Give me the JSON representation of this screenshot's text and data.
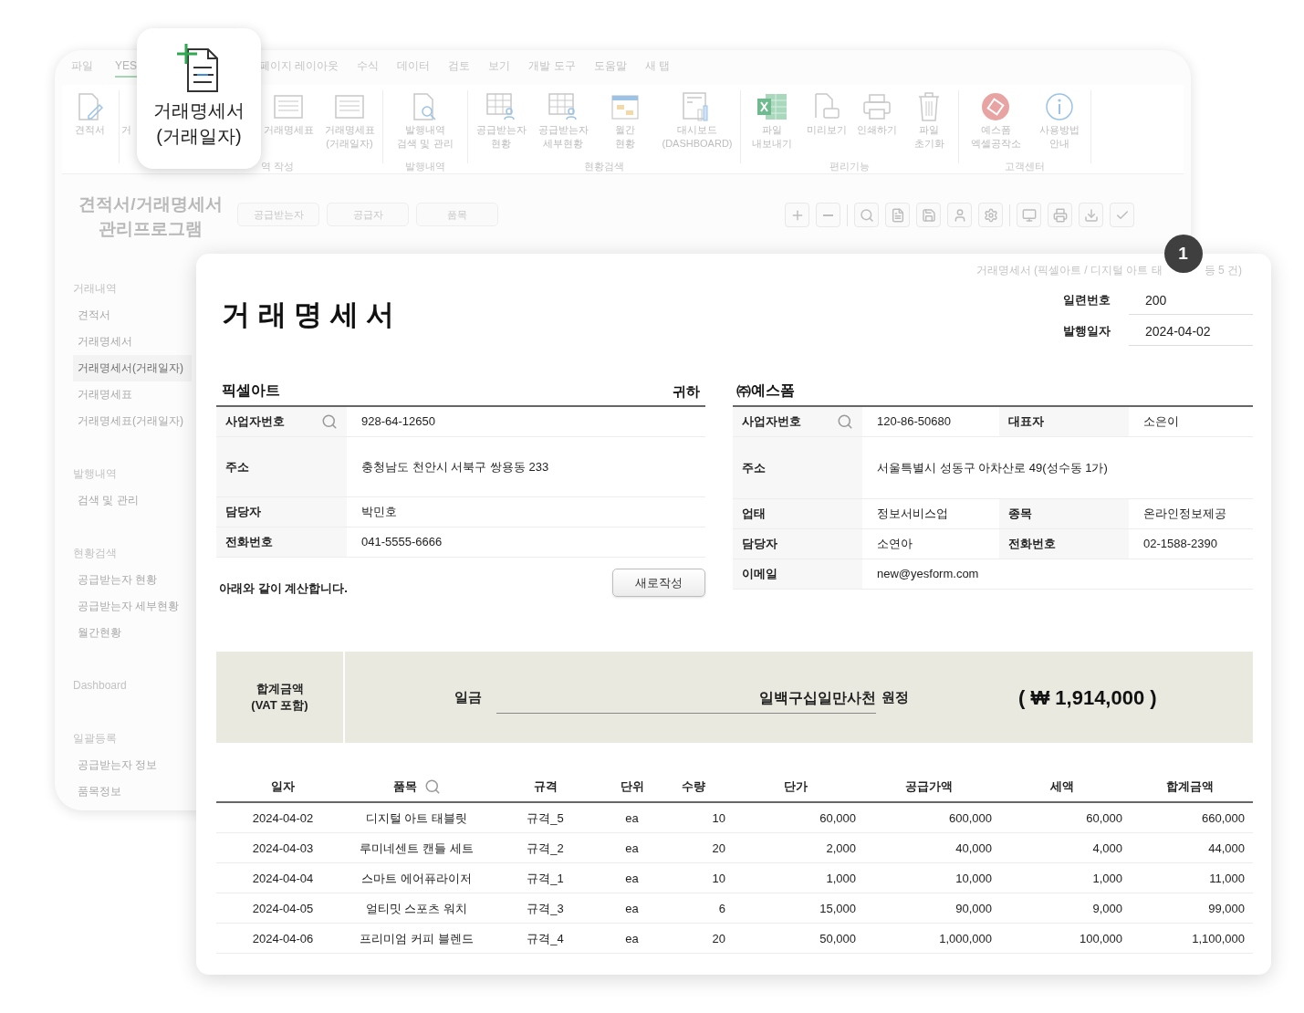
{
  "background_window": {
    "menu_tabs_left": [
      {
        "label": "파일",
        "selected": false
      },
      {
        "label": "YES",
        "selected": true
      }
    ],
    "menu_tabs_right": [
      {
        "label": "페이지 레이아웃",
        "selected": false
      },
      {
        "label": "수식",
        "selected": false
      },
      {
        "label": "데이터",
        "selected": false
      },
      {
        "label": "검토",
        "selected": false
      },
      {
        "label": "보기",
        "selected": false
      },
      {
        "label": "개발 도구",
        "selected": false
      },
      {
        "label": "도움말",
        "selected": false
      },
      {
        "label": "새 탭",
        "selected": false
      }
    ],
    "ribbon_left": [
      {
        "kind": "doc-edit",
        "label": "견적서"
      },
      {
        "kind": "cut",
        "label": "거"
      }
    ],
    "ribbon_groups": [
      {
        "label": "역 작성",
        "items": [
          {
            "kind": "sheet",
            "label": "거래명세표"
          },
          {
            "kind": "sheet",
            "label": "거래명세표\n(거래일자)"
          }
        ]
      },
      {
        "label": "발행내역",
        "items": [
          {
            "kind": "doc-search",
            "label": "발행내역\n검색 및 관리"
          }
        ]
      },
      {
        "label": "현황검색",
        "items": [
          {
            "kind": "grid-user",
            "label": "공급받는자\n현황"
          },
          {
            "kind": "grid-user",
            "label": "공급받는자\n세부현황"
          },
          {
            "kind": "calendar",
            "label": "월간\n현황"
          },
          {
            "kind": "dashboard",
            "label": "대시보드\n(DASHBOARD)"
          }
        ]
      },
      {
        "label": "편리기능",
        "items": [
          {
            "kind": "excel",
            "label": "파일\n내보내기"
          },
          {
            "kind": "doc-print",
            "label": "미리보기"
          },
          {
            "kind": "printer",
            "label": "인쇄하기"
          },
          {
            "kind": "trash",
            "label": "파일\n초기화"
          }
        ]
      },
      {
        "label": "고객센터",
        "items": [
          {
            "kind": "stamp",
            "label": "예스폼\n엑셀공작소"
          },
          {
            "kind": "info",
            "label": "사용방법\n안내"
          }
        ]
      }
    ],
    "sidebar": {
      "title": "견적서/거래명세서\n관리프로그램",
      "sections": [
        {
          "label": "거래내역",
          "items": [
            {
              "label": "견적서",
              "selected": false
            },
            {
              "label": "거래명세서",
              "selected": false
            },
            {
              "label": "거래명세서(거래일자)",
              "selected": true
            },
            {
              "label": "거래명세표",
              "selected": false
            },
            {
              "label": "거래명세표(거래일자)",
              "selected": false
            }
          ]
        },
        {
          "label": "발행내역",
          "items": [
            {
              "label": "검색 및 관리",
              "selected": false
            }
          ]
        },
        {
          "label": "현황검색",
          "items": [
            {
              "label": "공급받는자 현황",
              "selected": false
            },
            {
              "label": "공급받는자 세부현황",
              "selected": false
            },
            {
              "label": "월간현황",
              "selected": false
            }
          ]
        },
        {
          "label": "Dashboard"
        },
        {
          "label": "일괄등록",
          "items": [
            {
              "label": "공급받는자 정보",
              "selected": false
            },
            {
              "label": "품목정보",
              "selected": false
            }
          ]
        }
      ]
    },
    "filter_buttons": [
      "공급받는자",
      "공급자",
      "품목"
    ]
  },
  "callout": {
    "label": "거래명세서\n(거래일자)"
  },
  "document": {
    "summary_start": "거래명세서 (픽셀아트 / 디지털 아트 태",
    "summary_end": "등 5 건)",
    "badge": "1",
    "title": "거 래 명 세 서",
    "meta": [
      {
        "label": "일련번호",
        "value": "200"
      },
      {
        "label": "발행일자",
        "value": "2024-04-02"
      }
    ],
    "recipient": {
      "name": "픽셀아트",
      "suffix": "귀하",
      "rows": [
        {
          "kind": "lookup",
          "cells": [
            {
              "label": "사업자번호",
              "value": "928-64-12650"
            }
          ]
        },
        {
          "kind": "address",
          "cells": [
            {
              "label": "주소",
              "value": "충청남도 천안시 서북구 쌍용동 233"
            }
          ]
        },
        {
          "kind": "plain",
          "cells": [
            {
              "label": "담당자",
              "value": "박민호"
            }
          ]
        },
        {
          "kind": "plain",
          "cells": [
            {
              "label": "전화번호",
              "value": "041-5555-6666"
            }
          ]
        }
      ]
    },
    "note": "아래와 같이 계산합니다.",
    "new_button": "새로작성",
    "supplier": {
      "name": "㈜예스폼",
      "rows": [
        {
          "kind": "lookup",
          "cells": [
            {
              "label": "사업자번호",
              "value": "120-86-50680"
            },
            {
              "label": "대표자",
              "value": "소은이"
            }
          ]
        },
        {
          "kind": "address",
          "cells": [
            {
              "label": "주소",
              "value": "서울특별시 성동구 아차산로 49(성수동 1가)"
            }
          ]
        },
        {
          "kind": "plain",
          "cells": [
            {
              "label": "업태",
              "value": "정보서비스업"
            },
            {
              "label": "종목",
              "value": "온라인정보제공"
            }
          ]
        },
        {
          "kind": "plain",
          "cells": [
            {
              "label": "담당자",
              "value": "소연아"
            },
            {
              "label": "전화번호",
              "value": "02-1588-2390"
            }
          ]
        },
        {
          "kind": "plain",
          "cells": [
            {
              "label": "이메일",
              "value": "new@yesform.com"
            }
          ]
        }
      ]
    },
    "total": {
      "label": "합계금액\n(VAT 포함)",
      "prefix": "일금",
      "amount_words": "일백구십일만사천",
      "suffix": "원정",
      "amount": "( ₩ 1,914,000 )"
    },
    "items_table": {
      "columns": [
        "일자",
        "품목",
        "규격",
        "단위",
        "수량",
        "단가",
        "공급가액",
        "세액",
        "합계금액"
      ],
      "rows": [
        [
          "2024-04-02",
          "디지털 아트 태블릿",
          "규격_5",
          "ea",
          "10",
          "60,000",
          "600,000",
          "60,000",
          "660,000"
        ],
        [
          "2024-04-03",
          "루미네센트 캔들 세트",
          "규격_2",
          "ea",
          "20",
          "2,000",
          "40,000",
          "4,000",
          "44,000"
        ],
        [
          "2024-04-04",
          "스마트 에어퓨라이저",
          "규격_1",
          "ea",
          "10",
          "1,000",
          "10,000",
          "1,000",
          "11,000"
        ],
        [
          "2024-04-05",
          "얼티밋 스포츠 워치",
          "규격_3",
          "ea",
          "6",
          "15,000",
          "90,000",
          "9,000",
          "99,000"
        ],
        [
          "2024-04-06",
          "프리미엄 커피 블렌드",
          "규격_4",
          "ea",
          "20",
          "50,000",
          "1,000,000",
          "100,000",
          "1,100,000"
        ]
      ]
    }
  }
}
